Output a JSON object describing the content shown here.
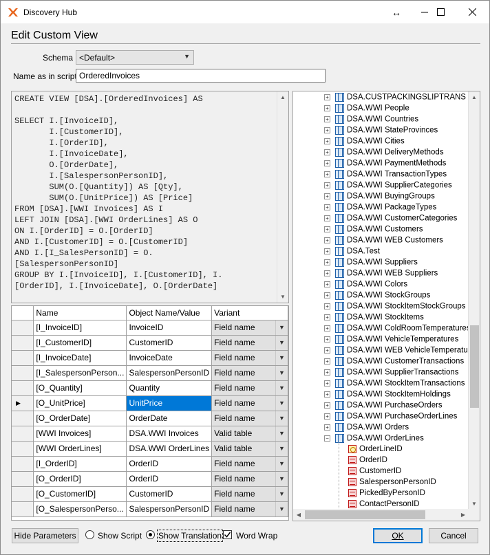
{
  "window": {
    "title": "Discovery Hub"
  },
  "heading": "Edit Custom View",
  "schema": {
    "label": "Schema",
    "value": "<Default>"
  },
  "name_in_script": {
    "label": "Name as in script",
    "value": "OrderedInvoices"
  },
  "sql": "CREATE VIEW [DSA].[OrderedInvoices] AS\n\nSELECT I.[InvoiceID],\n       I.[CustomerID],\n       I.[OrderID],\n       I.[InvoiceDate],\n       O.[OrderDate],\n       I.[SalespersonPersonID],\n       SUM(O.[Quantity]) AS [Qty],\n       SUM(O.[UnitPrice]) AS [Price]\nFROM [DSA].[WWI Invoices] AS I\nLEFT JOIN [DSA].[WWI OrderLines] AS O\nON I.[OrderID] = O.[OrderID]\nAND I.[CustomerID] = O.[CustomerID]\nAND I.[I_SalesPersonID] = O.\n[SalespersonPersonID]\nGROUP BY I.[InvoiceID], I.[CustomerID], I.\n[OrderID], I.[InvoiceDate], O.[OrderDate]",
  "grid": {
    "columns": [
      "Name",
      "Object Name/Value",
      "Variant"
    ],
    "rows": [
      {
        "name": "[I_InvoiceID]",
        "object": "InvoiceID",
        "variant": "Field name"
      },
      {
        "name": "[I_CustomerID]",
        "object": "CustomerID",
        "variant": "Field name"
      },
      {
        "name": "[I_InvoiceDate]",
        "object": "InvoiceDate",
        "variant": "Field name"
      },
      {
        "name": "[I_SalespersonPerson...",
        "object": "SalespersonPersonID",
        "variant": "Field name"
      },
      {
        "name": "[O_Quantity]",
        "object": "Quantity",
        "variant": "Field name"
      },
      {
        "name": "[O_UnitPrice]",
        "object": "UnitPrice",
        "variant": "Field name"
      },
      {
        "name": "[O_OrderDate]",
        "object": "OrderDate",
        "variant": "Field name"
      },
      {
        "name": "[WWI Invoices]",
        "object": "DSA.WWI Invoices",
        "variant": "Valid table"
      },
      {
        "name": "[WWI OrderLines]",
        "object": "DSA.WWI OrderLines",
        "variant": "Valid table"
      },
      {
        "name": "[I_OrderID]",
        "object": "OrderID",
        "variant": "Field name"
      },
      {
        "name": "[O_OrderID]",
        "object": "OrderID",
        "variant": "Field name"
      },
      {
        "name": "[O_CustomerID]",
        "object": "CustomerID",
        "variant": "Field name"
      },
      {
        "name": "[O_SalespersonPerso...",
        "object": "SalespersonPersonID",
        "variant": "Field name"
      }
    ]
  },
  "tree": {
    "tables": [
      "DSA.CUSTPACKINGSLIPTRANS",
      "DSA.WWI People",
      "DSA.WWI Countries",
      "DSA.WWI StateProvinces",
      "DSA.WWI Cities",
      "DSA.WWI DeliveryMethods",
      "DSA.WWI PaymentMethods",
      "DSA.WWI TransactionTypes",
      "DSA.WWI SupplierCategories",
      "DSA.WWI BuyingGroups",
      "DSA.WWI PackageTypes",
      "DSA.WWI CustomerCategories",
      "DSA.WWI Customers",
      "DSA.WWI WEB Customers",
      "DSA.Test",
      "DSA.WWI Suppliers",
      "DSA.WWI WEB Suppliers",
      "DSA.WWI Colors",
      "DSA.WWI StockGroups",
      "DSA.WWI StockItemStockGroups",
      "DSA.WWI StockItems",
      "DSA.WWI ColdRoomTemperatures",
      "DSA.WWI VehicleTemperatures",
      "DSA.WWI WEB VehicleTemperatures",
      "DSA.WWI CustomerTransactions",
      "DSA.WWI SupplierTransactions",
      "DSA.WWI StockItemTransactions",
      "DSA.WWI StockItemHoldings",
      "DSA.WWI PurchaseOrders",
      "DSA.WWI PurchaseOrderLines",
      "DSA.WWI Orders",
      "DSA.WWI OrderLines"
    ],
    "fields": [
      "OrderLineID",
      "OrderID",
      "CustomerID",
      "SalespersonPersonID",
      "PickedByPersonID",
      "ContactPersonID"
    ]
  },
  "footer": {
    "hide_parameters": "Hide Parameters",
    "show_script": "Show Script",
    "show_translation": "Show Translation",
    "word_wrap": "Word Wrap",
    "ok": "OK",
    "cancel": "Cancel"
  }
}
